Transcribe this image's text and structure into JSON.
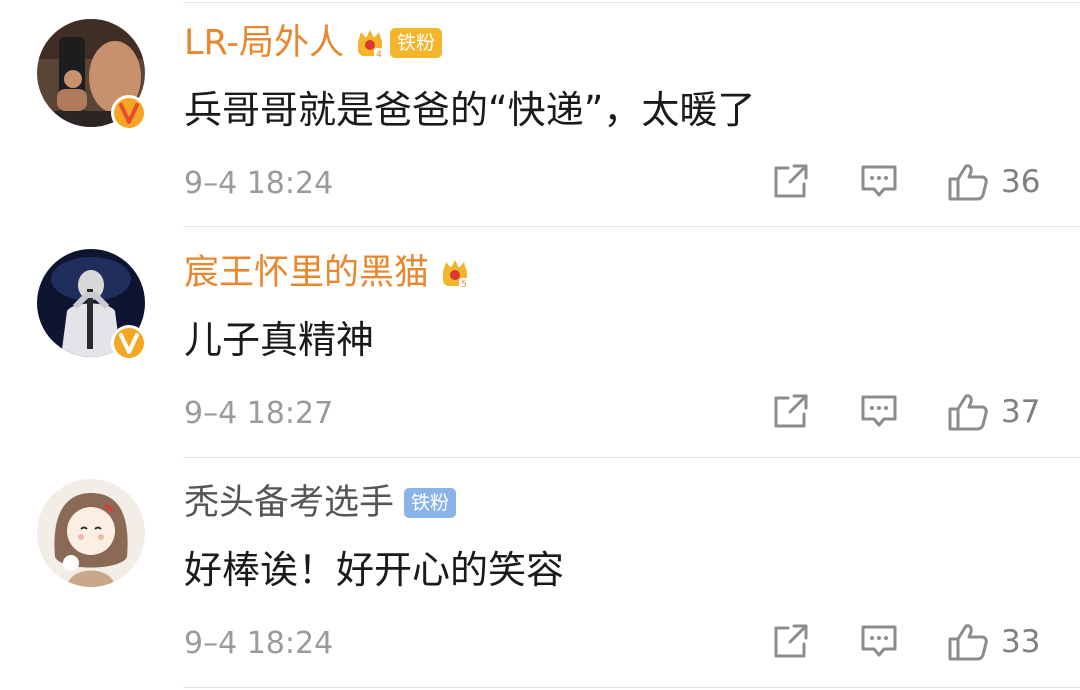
{
  "colors": {
    "vip_name": "#e8872e",
    "normal_name": "#555555",
    "iron_fan_gold": "#f3b52c",
    "iron_fan_blue": "#8ab3ea",
    "verified_badge": "#f5a623",
    "icon_gray": "#8c8c8c"
  },
  "comments": [
    {
      "username": "LR-局外人",
      "crown_level": "4",
      "fan_tag": "铁粉",
      "text": "兵哥哥就是爸爸的“快递”，太暖了",
      "time": "9–4 18:24",
      "likes": "36"
    },
    {
      "username": "宸王怀里的黑猫",
      "crown_level": "5",
      "text": "儿子真精神",
      "time": "9–4 18:27",
      "likes": "37"
    },
    {
      "username": "秃头备考选手",
      "fan_tag": "铁粉",
      "text": "好棒诶！好开心的笑容",
      "time": "9–4 18:24",
      "likes": "33"
    }
  ]
}
